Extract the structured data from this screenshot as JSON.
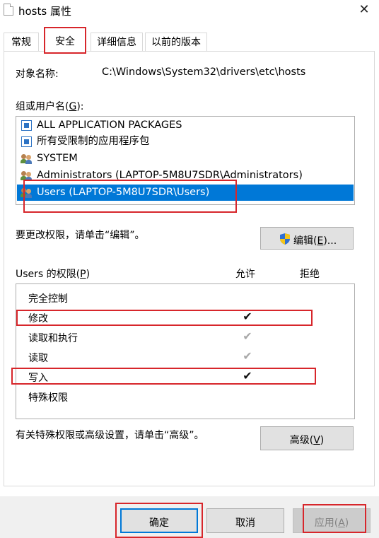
{
  "window": {
    "title": "hosts 属性",
    "close_label": "✕"
  },
  "tabs": [
    {
      "label": "常规"
    },
    {
      "label": "安全"
    },
    {
      "label": "详细信息"
    },
    {
      "label": "以前的版本"
    }
  ],
  "object": {
    "label": "对象名称:",
    "value": "C:\\Windows\\System32\\drivers\\etc\\hosts"
  },
  "groups": {
    "label": "组或用户名(G):",
    "items": [
      {
        "label": "ALL APPLICATION PACKAGES",
        "icon": "package-icon"
      },
      {
        "label": "所有受限制的应用程序包",
        "icon": "package-icon"
      },
      {
        "label": "SYSTEM",
        "icon": "users-icon"
      },
      {
        "label": "Administrators (LAPTOP-5M8U7SDR\\Administrators)",
        "icon": "users-icon"
      },
      {
        "label": "Users (LAPTOP-5M8U7SDR\\Users)",
        "icon": "users-icon",
        "selected": true
      }
    ]
  },
  "edit": {
    "hint": "要更改权限，请单击“编辑”。",
    "button_label": "编辑(E)...",
    "icon": "shield-icon"
  },
  "permissions": {
    "label": "Users 的权限(P)",
    "allow_header": "允许",
    "deny_header": "拒绝",
    "rows": [
      {
        "name": "完全控制",
        "allow": "",
        "deny": ""
      },
      {
        "name": "修改",
        "allow": "✔",
        "deny": ""
      },
      {
        "name": "读取和执行",
        "allow": "✔",
        "deny": ""
      },
      {
        "name": "读取",
        "allow": "✔",
        "deny": ""
      },
      {
        "name": "写入",
        "allow": "✔",
        "deny": ""
      },
      {
        "name": "特殊权限",
        "allow": "",
        "deny": ""
      }
    ]
  },
  "advanced": {
    "hint": "有关特殊权限或高级设置，请单击“高级”。",
    "button_label": "高级(V)"
  },
  "footer": {
    "ok_label": "确定",
    "cancel_label": "取消",
    "apply_label": "应用(A)"
  },
  "colors": {
    "selection": "#0078d7",
    "annotation": "#d7262b"
  }
}
